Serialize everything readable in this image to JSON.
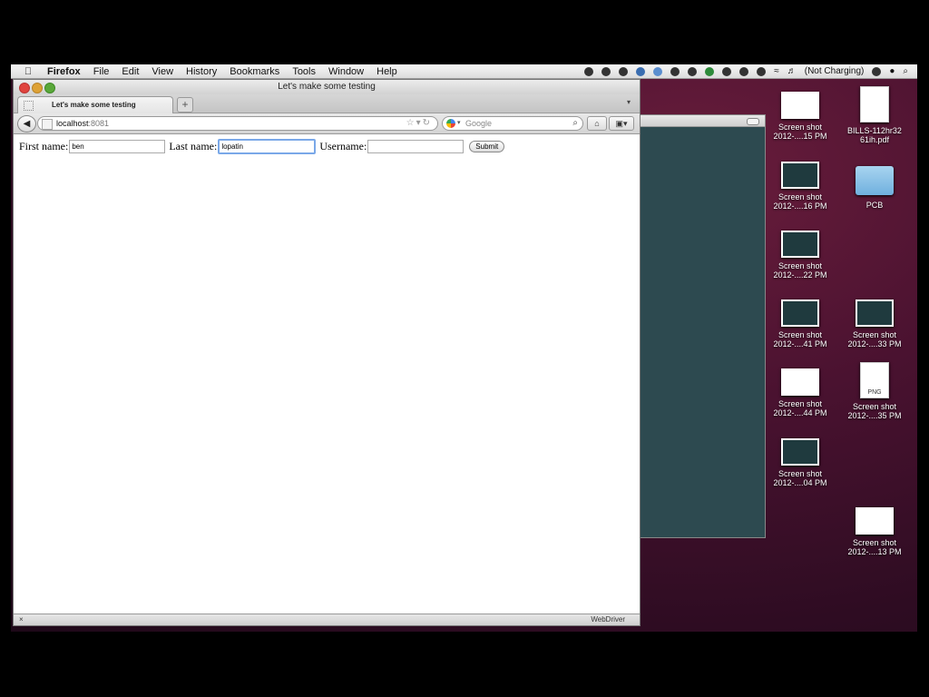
{
  "menubar": {
    "app_name": "Firefox",
    "items": [
      "File",
      "Edit",
      "View",
      "History",
      "Bookmarks",
      "Tools",
      "Window",
      "Help"
    ],
    "battery_status": "(Not Charging)"
  },
  "window": {
    "title": "Let's make some testing",
    "tab_label": "Let's make some testing",
    "new_tab_glyph": "+",
    "url_host": "localhost",
    "url_port": ":8081",
    "search_placeholder": "Google",
    "status_left": "×",
    "status_right": "WebDriver"
  },
  "form": {
    "first_label": "First name:",
    "first_value": "ben",
    "last_label": "Last name:",
    "last_value": "lopatin",
    "user_label": "Username:",
    "user_value": "",
    "submit_label": "Submit"
  },
  "desktop_icons": [
    {
      "line1": "Screen shot",
      "line2": "2012-....15 PM",
      "kind": "thumb-white"
    },
    {
      "line1": "BILLS-112hr32",
      "line2": "61ih.pdf",
      "kind": "doc"
    },
    {
      "line1": "Screen shot",
      "line2": "2012-....16 PM",
      "kind": "thumb-dark"
    },
    {
      "line1": "PCB",
      "line2": "",
      "kind": "folder"
    },
    {
      "line1": "Screen shot",
      "line2": "2012-....22 PM",
      "kind": "thumb-dark"
    },
    {
      "line1": "Screen shot",
      "line2": "2012-....41 PM",
      "kind": "thumb-dark"
    },
    {
      "line1": "Screen shot",
      "line2": "2012-....33 PM",
      "kind": "thumb-dark"
    },
    {
      "line1": "Screen shot",
      "line2": "2012-....44 PM",
      "kind": "thumb-white"
    },
    {
      "line1": "Screen shot",
      "line2": "2012-....35 PM",
      "kind": "png"
    },
    {
      "line1": "Screen shot",
      "line2": "2012-....04 PM",
      "kind": "thumb-dark"
    },
    {
      "line1": "Screen shot",
      "line2": "2012-....13 PM",
      "kind": "thumb-white"
    }
  ],
  "png_badge": "PNG"
}
